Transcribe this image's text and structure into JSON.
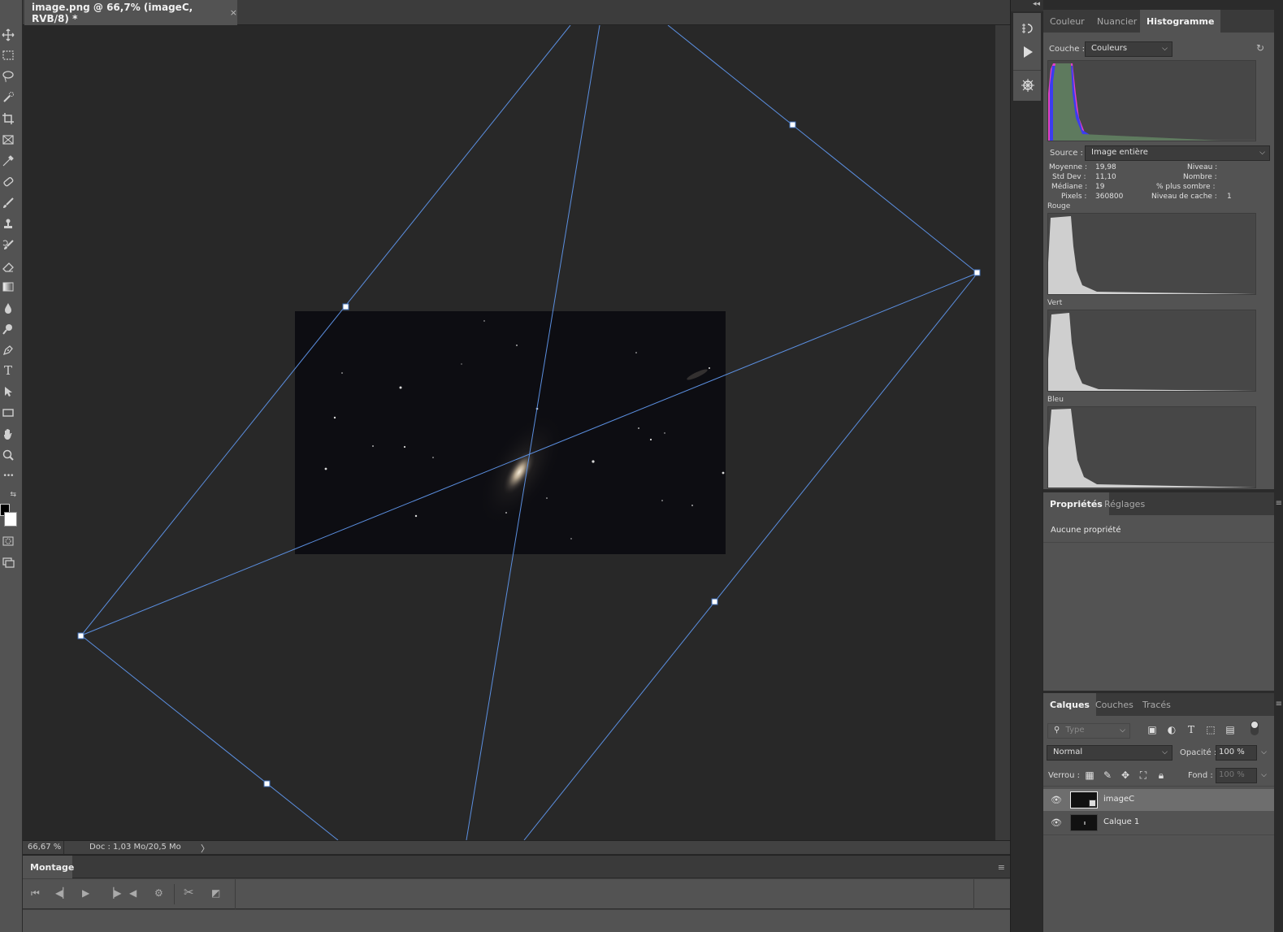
{
  "document": {
    "tab_title": "image.png @ 66,7% (imageC, RVB/8) *",
    "close_glyph": "×"
  },
  "status": {
    "zoom": "66,67 %",
    "doc_size": "Doc : 1,03 Mo/20,5 Mo",
    "arrow_glyph": "〉"
  },
  "timeline": {
    "tab_label": "Montage",
    "menu_glyph": "≡",
    "controls": [
      "first-frame",
      "previous-frame",
      "play",
      "next-frame",
      "audio",
      "settings",
      "split",
      "transition"
    ]
  },
  "toolbar": {
    "tools": [
      "move-tool",
      "marquee-tool",
      "lasso-tool",
      "quick-selection-tool",
      "crop-tool",
      "frame-tool",
      "eyedropper-tool",
      "healing-brush-tool",
      "brush-tool",
      "clone-stamp-tool",
      "history-brush-tool",
      "eraser-tool",
      "gradient-tool",
      "blur-tool",
      "dodge-tool",
      "pen-tool",
      "type-tool",
      "path-selection-tool",
      "rectangle-tool",
      "hand-tool",
      "zoom-tool",
      "more-tools"
    ],
    "type_glyph": "T",
    "more_glyph": "•••",
    "foreground_color": "#000000",
    "background_color": "#ffffff"
  },
  "midcol": {
    "collapse_glyph": "◂◂",
    "buttons": [
      "history-icon",
      "play-action-icon",
      "brush-settings-icon"
    ]
  },
  "histogram_panel": {
    "tabs": [
      "Couleur",
      "Nuancier",
      "Histogramme"
    ],
    "active_tab": "Histogramme",
    "channel_label": "Couche :",
    "channel_value": "Couleurs",
    "source_label": "Source :",
    "source_value": "Image entière",
    "stats": {
      "moyenne_label": "Moyenne :",
      "moyenne": "19,98",
      "stddev_label": "Std Dev :",
      "stddev": "11,10",
      "mediane_label": "Médiane :",
      "mediane": "19",
      "pixels_label": "Pixels :",
      "pixels": "360800",
      "niveau_label": "Niveau :",
      "nombre_label": "Nombre :",
      "sombre_label": "% plus sombre :",
      "cache_label": "Niveau de cache :",
      "cache": "1"
    },
    "channels": [
      "Rouge",
      "Vert",
      "Bleu"
    ]
  },
  "properties_panel": {
    "tabs": [
      "Propriétés",
      "Réglages"
    ],
    "active_tab": "Propriétés",
    "empty_text": "Aucune propriété"
  },
  "layers_panel": {
    "tabs": [
      "Calques",
      "Couches",
      "Tracés"
    ],
    "active_tab": "Calques",
    "search_placeholder": "Type",
    "blend_mode": "Normal",
    "opacity_label": "Opacité :",
    "opacity_value": "100 %",
    "lock_label": "Verrou :",
    "fill_label": "Fond :",
    "fill_value": "100 %",
    "layers": [
      {
        "name": "imageC",
        "selected": true
      },
      {
        "name": "Calque 1",
        "selected": false
      }
    ]
  },
  "colors": {
    "guide_line": "#5b8fe0",
    "panel_bg": "#535353",
    "canvas_bg": "#282828"
  }
}
